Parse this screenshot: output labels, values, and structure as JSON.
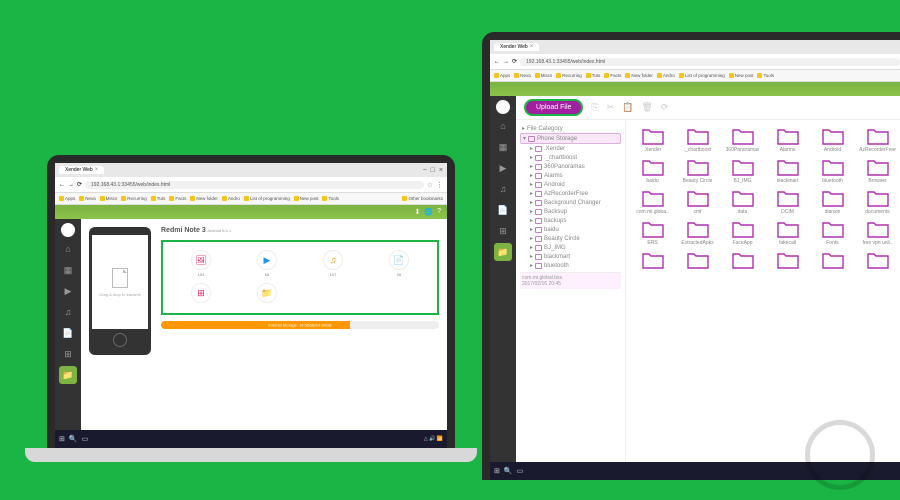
{
  "laptop1": {
    "tab_title": "Xender Web",
    "url": "192.168.43.1:33455/web/index.html",
    "bookmarks": [
      "Apps",
      "Neva",
      "Miscs",
      "Recurring",
      "Tuts",
      "Facts",
      "New folder",
      "Andro",
      "List of programming",
      "New post",
      "Tools"
    ],
    "other_bookmarks": "Other bookmarks",
    "device_name": "Redmi Note 3",
    "device_os": "Android 6.0.1",
    "categories": [
      {
        "icon": "🖼",
        "label": "154",
        "color": "#e91e63"
      },
      {
        "icon": "▶",
        "label": "68",
        "color": "#2196f3"
      },
      {
        "icon": "♫",
        "label": "107",
        "color": "#ff9800"
      },
      {
        "icon": "📄",
        "label": "26",
        "color": "#4caf50"
      },
      {
        "icon": "⊞",
        "label": "",
        "color": "#e91e63"
      },
      {
        "icon": "📁",
        "label": "",
        "color": "#9c27b0"
      }
    ],
    "storage_label": "Internal Storage: 14.58GB/24.60GB",
    "phone_hint": "Drag & drop to transmit"
  },
  "laptop2": {
    "tab_title": "Xender Web",
    "url": "192.168.43.1:33455/web/index.html",
    "bookmarks": [
      "Apps",
      "Neva",
      "Miscs",
      "Recurring",
      "Tuts",
      "Facts",
      "New folder",
      "Andro",
      "List of programming",
      "New post",
      "Tools"
    ],
    "upload_btn": "Upload File",
    "tree_header": "File Category",
    "phone_storage": "Phone Storage",
    "tree_items": [
      ".Xender",
      "._chartboost",
      "360Panoramas",
      "Alarms",
      "Android",
      "AzRecorderFree",
      "Background Changer",
      "Backsup",
      "backups",
      "baidu",
      "Beauty Circle",
      "BJ_IMG",
      "blackmart",
      "bluetooth"
    ],
    "tree_footer_path": "com.mi.global.bss",
    "tree_footer_date": "2017/02/16 20:45",
    "folders": [
      ".Xender",
      "._chartboost",
      "360Panoramas",
      "Alarms",
      "Android",
      "AzRecorderFree",
      "baidu",
      "Beauty Circle",
      "BJ_IMG",
      "blackmart",
      "bluetooth",
      "Browser",
      "com.mi.globa..",
      "cmf",
      "data",
      "DCIM",
      "dianxin",
      "documents",
      "ERS",
      "ExtractedApks",
      "FaceApp",
      "fakecall",
      "Fonts",
      "free vpn unli..",
      "",
      "",
      "",
      "",
      "",
      ""
    ]
  }
}
